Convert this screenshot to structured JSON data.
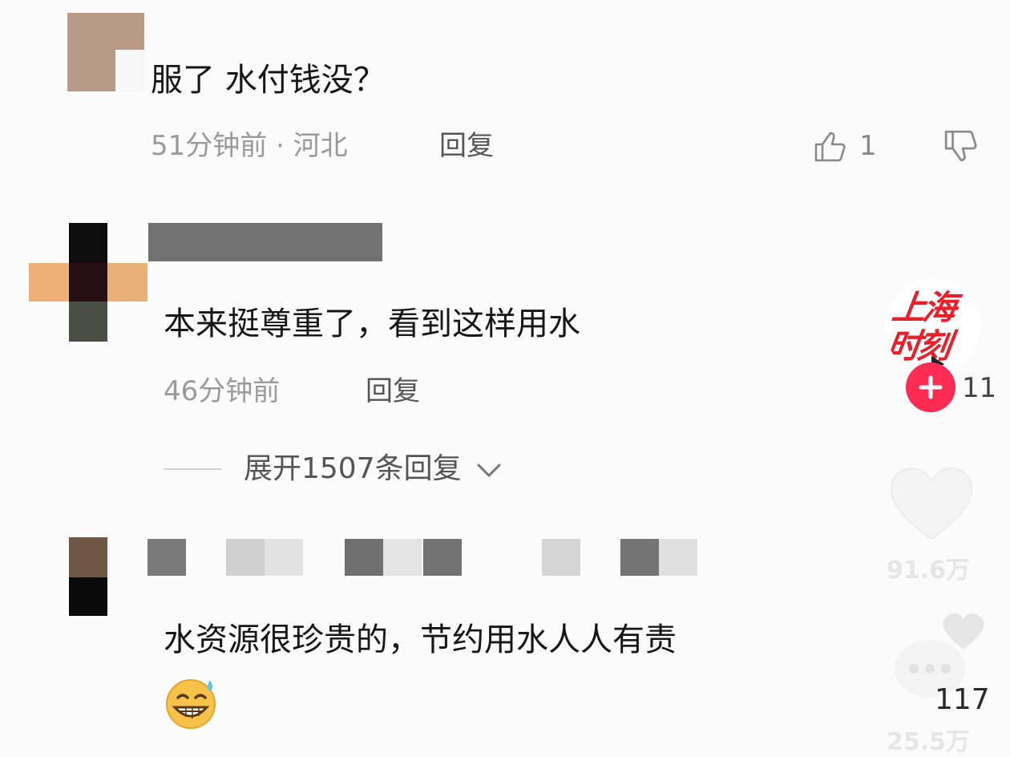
{
  "comments": [
    {
      "text": "服了 水付钱没？",
      "meta": "51分钟前 · 河北",
      "reply_label": "回复",
      "like_count": "1"
    },
    {
      "text": "本来挺尊重了，看到这样用水",
      "meta": "46分钟前",
      "reply_label": "回复",
      "expand_label": "展开1507条回复"
    },
    {
      "text": "水资源很珍贵的，节约用水人人有责",
      "emoji": "😅"
    }
  ],
  "side_panel": {
    "channel_name_line1": "上海",
    "channel_name_line2": "时刻",
    "follow_count_partial": "11",
    "like_count": "91.6万",
    "comment_count": "117",
    "share_count": "25.5万"
  },
  "colors": {
    "brand_red": "#e8202a",
    "follow_pink": "#fe2c55",
    "redaction_dark": "#757575"
  }
}
